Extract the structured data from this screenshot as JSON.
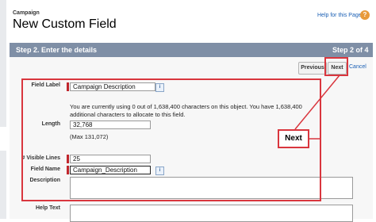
{
  "header": {
    "breadcrumb": "Campaign",
    "title": "New Custom Field",
    "help_link": "Help for this Page",
    "help_icon": "question-icon"
  },
  "step_bar": {
    "title": "Step 2. Enter the details",
    "count": "Step 2 of 4"
  },
  "buttons": {
    "previous": "Previous",
    "next": "Next",
    "cancel": "Cancel"
  },
  "form": {
    "field_label": {
      "label": "Field Label",
      "value": "Campaign Description"
    },
    "info_text": "You are currently using 0 out of 1,638,400 characters on this object. You have 1,638,400 additional characters to allocate to this field.",
    "length": {
      "label": "Length",
      "value": "32,768",
      "max": "(Max 131,072)"
    },
    "visible_lines": {
      "label": "# Visible Lines",
      "value": "25"
    },
    "field_name": {
      "label": "Field Name",
      "value": "Campaign_Description"
    },
    "description": {
      "label": "Description",
      "value": ""
    },
    "help_text": {
      "label": "Help Text",
      "value": ""
    },
    "info_icon_glyph": "i"
  },
  "annotation": {
    "callout_label": "Next",
    "highlight_color": "#d9363e"
  },
  "colors": {
    "step_bar": "#7f8fa6",
    "link": "#1a5fb4",
    "required": "#c0262d"
  }
}
